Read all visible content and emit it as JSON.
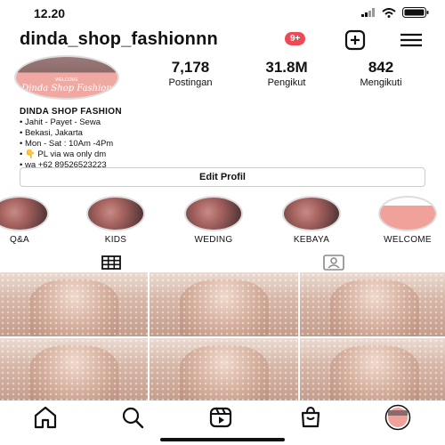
{
  "status": {
    "time": "12.20"
  },
  "header": {
    "username": "dinda_shop_fashionnn",
    "notifications": "9+"
  },
  "avatar": {
    "brand": "Dinda Shop Fashion",
    "tag": "WELCOME"
  },
  "stats": [
    {
      "value": "7,178",
      "label": "Postingan"
    },
    {
      "value": "31.8M",
      "label": "Pengikut"
    },
    {
      "value": "842",
      "label": "Mengikuti"
    }
  ],
  "bio": {
    "name": "DINDA SHOP FASHION",
    "lines": [
      "• Jahit - Payet - Sewa",
      "• Bekasi, Jakarta",
      "• Mon - Sat : 10Am -4Pm",
      "• 👇 PL via wa only dm",
      "• wa +62 89526523223"
    ]
  },
  "edit_profile": "Edit Profil",
  "highlights": [
    {
      "label": "Q&A"
    },
    {
      "label": "KIDS"
    },
    {
      "label": "WEDING"
    },
    {
      "label": "KEBAYA"
    },
    {
      "label": "WELCOME"
    }
  ],
  "tabs": [
    {
      "icon": "grid-icon"
    },
    {
      "icon": "tagged-icon"
    }
  ],
  "nav": [
    {
      "icon": "home-icon"
    },
    {
      "icon": "search-icon"
    },
    {
      "icon": "reels-icon"
    },
    {
      "icon": "shop-icon"
    },
    {
      "icon": "profile-icon"
    }
  ]
}
